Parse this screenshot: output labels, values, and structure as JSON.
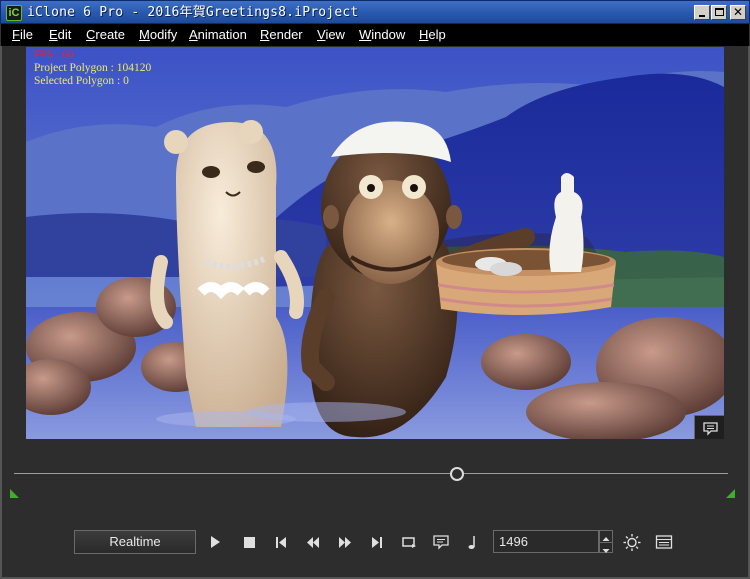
{
  "window": {
    "app_icon_glyph": "iC",
    "title": "iClone 6 Pro - 2016年賀Greetings8.iProject",
    "minimize_glyph": "",
    "maximize_glyph": "",
    "close_glyph": "✕"
  },
  "menu": [
    "File",
    "Edit",
    "Create",
    "Modify",
    "Animation",
    "Render",
    "View",
    "Window",
    "Help"
  ],
  "viewport": {
    "fps": "FPS : 60",
    "project_polygon": "Project Polygon : 104120",
    "selected_polygon": "Selected Polygon : 0",
    "scene": "3D scene: white seal character and chimpanzee with towel on head holding wooden bucket with sake bottle in a hot spring, mountains behind",
    "chat_icon": "speech-bubble-icon"
  },
  "timeline": {
    "playhead_position": 0.62
  },
  "transport": {
    "realtime_label": "Realtime",
    "frame_value": "1496",
    "icons": [
      "play-icon",
      "stop-icon",
      "skip-to-start-icon",
      "rewind-icon",
      "fast-forward-icon",
      "skip-to-end-icon",
      "loop-icon",
      "subtitle-icon",
      "music-note-icon",
      "brightness-icon",
      "panel-icon"
    ]
  },
  "colors": {
    "accent_green": "#3fae2d",
    "fps_red": "#e2233b",
    "stats_yellow": "#f1e86a",
    "titlebar_blue": "#2a5bb0"
  }
}
